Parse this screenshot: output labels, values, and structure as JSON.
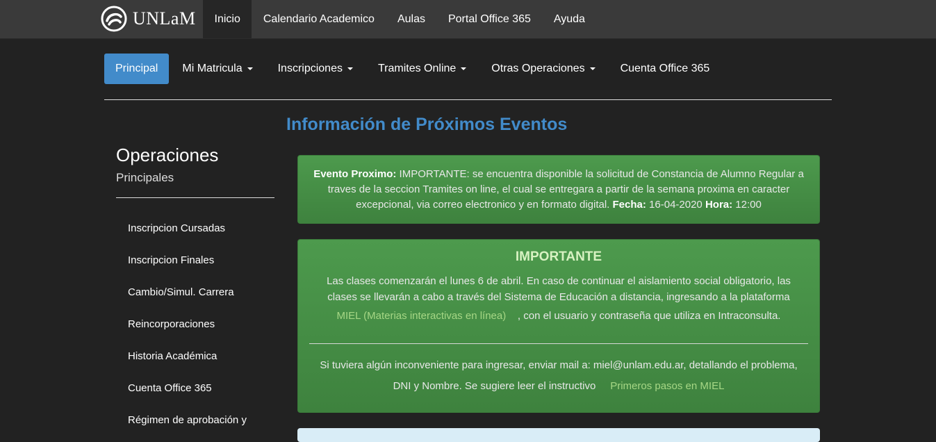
{
  "brand": {
    "name": "UNLaM"
  },
  "top_nav": [
    "Inicio",
    "Calendario Academico",
    "Aulas",
    "Portal Office 365",
    "Ayuda"
  ],
  "sub_nav": [
    {
      "label": "Principal"
    },
    {
      "label": "Mi Matricula"
    },
    {
      "label": "Inscripciones"
    },
    {
      "label": "Tramites Online"
    },
    {
      "label": "Otras Operaciones"
    },
    {
      "label": "Cuenta Office 365"
    }
  ],
  "main": {
    "title": "Información de Próximos Eventos"
  },
  "sidebar": {
    "heading": "Operaciones",
    "subheading": "Principales",
    "items": [
      "Inscripcion Cursadas",
      "Inscripcion Finales",
      "Cambio/Simul. Carrera",
      "Reincorporaciones",
      "Historia Académica",
      "Cuenta Office 365",
      "Régimen de aprobación y"
    ]
  },
  "event": {
    "label": "Evento Proximo:",
    "text": " IMPORTANTE: se encuentra disponible la solicitud de Constancia de Alumno Regular a traves de la seccion Tramites on line, el cual se entregara a partir de la semana proxima en caracter excepcional, via correo electronico y en formato digital. ",
    "date_label": "Fecha:",
    "date": " 16-04-2020 ",
    "time_label": "Hora:",
    "time": " 12:00"
  },
  "important": {
    "title": "IMPORTANTE",
    "body": "Las clases comenzarán el lunes 6 de abril. En caso de continuar el aislamiento social obligatorio, las clases se llevarán a cabo a través del Sistema de Educación a distancia, ingresando a la plataforma",
    "link_miel": "MIEL (Materias interactivas en línea)",
    "after_link": ", con el usuario y contraseña que utiliza en Intraconsulta.",
    "contact": "Si tuviera algún inconveniente para ingresar, enviar mail a: miel@unlam.edu.ar, detallando el problema, DNI y Nombre. Se sugiere leer el instructivo",
    "link_steps": "Primeros pasos en MIEL"
  }
}
